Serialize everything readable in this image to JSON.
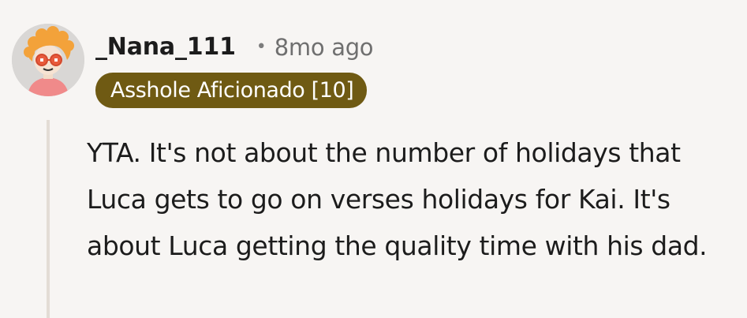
{
  "comment": {
    "username": "_Nana_111",
    "separator": "•",
    "timestamp": "8mo ago",
    "flair": "Asshole Aficionado [10]",
    "flair_color": "#6f5a13",
    "avatar_icon": "user-avatar-icon",
    "body": "YTA. It's not about the number of holidays that Luca gets to go on verses holidays for Kai. It's about Luca getting the quality time with his dad."
  }
}
